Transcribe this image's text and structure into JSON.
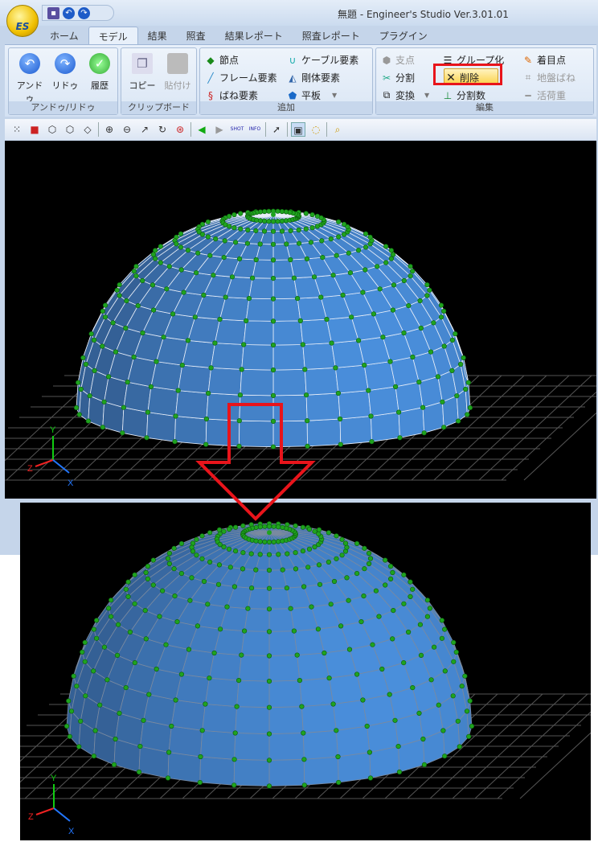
{
  "window": {
    "title": "無題 - Engineer's Studio Ver.3.01.01",
    "app_logo": "ES"
  },
  "quick_access": [
    "save-icon",
    "undo-icon",
    "redo-icon"
  ],
  "tabs": [
    "ホーム",
    "モデル",
    "結果",
    "照査",
    "結果レポート",
    "照査レポート",
    "プラグイン"
  ],
  "active_tab": "モデル",
  "ribbon": {
    "undo_group": {
      "label": "アンドゥ/リドゥ",
      "undo": "アンドゥ",
      "redo": "リドゥ",
      "history": "履歴"
    },
    "clipboard_group": {
      "label": "クリップボード",
      "copy": "コピー",
      "paste": "貼付け"
    },
    "add_group": {
      "label": "追加",
      "node": "節点",
      "frame": "フレーム要素",
      "spring": "ばね要素",
      "cable": "ケーブル要素",
      "rigid": "剛体要素",
      "plate": "平板"
    },
    "edit_group": {
      "label": "編集",
      "support": "支点",
      "split": "分割",
      "transform": "変換",
      "group": "グループ化",
      "delete": "削除",
      "divisions": "分割数",
      "focus": "着目点",
      "ground_spring": "地盤ばね",
      "live_load": "活荷重"
    }
  },
  "toolbar": {
    "shot": "SHOT",
    "info": "INFO"
  },
  "axes": {
    "y": "Y",
    "z": "Z",
    "x": "X"
  },
  "colors": {
    "highlight": "#e8141b",
    "dome": "#4a8fd8",
    "node": "#1fa31f"
  }
}
